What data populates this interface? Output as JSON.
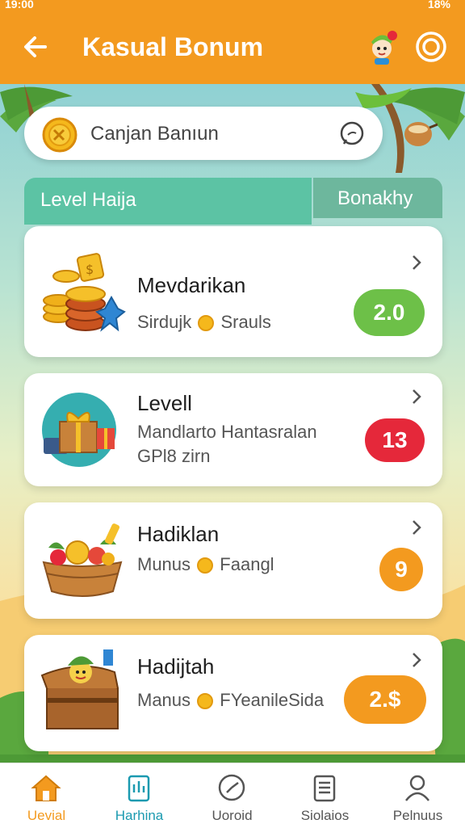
{
  "status_bar": {
    "left": "19:00 ",
    "right": "18%"
  },
  "header": {
    "title": "Kasual Bonum"
  },
  "search": {
    "text": "Canjan Banıun"
  },
  "tabs": [
    {
      "label": "Level Haija"
    },
    {
      "label": "Bonakhy"
    }
  ],
  "cards": [
    {
      "title": "Mevdarikan",
      "sub1": "Sirdujk",
      "sub2": "Srauls",
      "badge": "2.0",
      "badge_color": "#6dc048"
    },
    {
      "title": "Levell",
      "sub1": "Mandlarto Hantasralan",
      "sub2": "GPl8 zirn",
      "badge": "13",
      "badge_color": "#e5283a"
    },
    {
      "title": "Hadiklan",
      "sub1": "Munus",
      "sub2": "Faangl",
      "badge": "9",
      "badge_color": "#f39a1f"
    },
    {
      "title": "Hadijtah",
      "sub1": "Manus",
      "sub2": "FYeanileSida",
      "badge": "2.$",
      "badge_color": "#f39a1f"
    }
  ],
  "bottom_nav": [
    {
      "label": "Uevial",
      "active": true
    },
    {
      "label": "Harhina"
    },
    {
      "label": "Uoroid"
    },
    {
      "label": "Siolaios"
    },
    {
      "label": "Pelnuus"
    }
  ],
  "colors": {
    "accent": "#f39a1f",
    "teal": "#5cc3a4",
    "active_label": "#f39a1f",
    "second_label": "#1b9ab0"
  }
}
